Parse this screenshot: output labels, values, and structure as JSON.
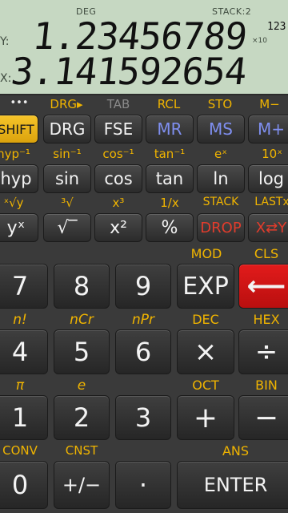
{
  "display": {
    "mode": "DEG",
    "stack_label": "STACK:2",
    "y_register_label": "Y:",
    "x_register_label": "X:",
    "y_value": "1.23456789",
    "y_exponent_base": "×10",
    "y_exponent": "123",
    "x_value": "3.141592654"
  },
  "row1": {
    "top_labels": [
      "•••",
      "DRG▸",
      "TAB",
      "RCL",
      "STO",
      "M−"
    ],
    "buttons": [
      "SHIFT",
      "DRG",
      "FSE",
      "MR",
      "MS",
      "M+"
    ]
  },
  "row2": {
    "top_labels": [
      "hyp⁻¹",
      "sin⁻¹",
      "cos⁻¹",
      "tan⁻¹",
      "eˣ",
      "10ˣ"
    ],
    "buttons": [
      "hyp",
      "sin",
      "cos",
      "tan",
      "ln",
      "log"
    ]
  },
  "row3": {
    "top_labels": [
      "ˣ√y",
      "³√",
      "x³",
      "1/x",
      "STACK",
      "LASTx"
    ],
    "buttons": [
      "yˣ",
      "√‾",
      "x²",
      "%",
      "DROP",
      "X⇄Y"
    ]
  },
  "row4": {
    "top_labels": [
      "",
      "",
      "",
      "MOD",
      "CLS"
    ],
    "buttons": [
      "7",
      "8",
      "9",
      "EXP",
      "⟵"
    ]
  },
  "row5": {
    "top_labels": [
      "n!",
      "nCr",
      "nPr",
      "DEC",
      "HEX"
    ],
    "buttons": [
      "4",
      "5",
      "6",
      "×",
      "÷"
    ]
  },
  "row6": {
    "top_labels": [
      "π",
      "e",
      "",
      "OCT",
      "BIN"
    ],
    "buttons": [
      "1",
      "2",
      "3",
      "+",
      "−"
    ]
  },
  "row7": {
    "top_labels": [
      "CONV",
      "CNST",
      "",
      "ANS"
    ],
    "buttons": [
      "0",
      "+/−",
      "·",
      "ENTER"
    ]
  },
  "colors": {
    "lcd_background": "#c6d8c2",
    "shift_yellow": "#f0b400",
    "memory_blue": "#7f8ff0",
    "drop_red": "#e23c2c",
    "backspace_red": "#e21b1b"
  }
}
